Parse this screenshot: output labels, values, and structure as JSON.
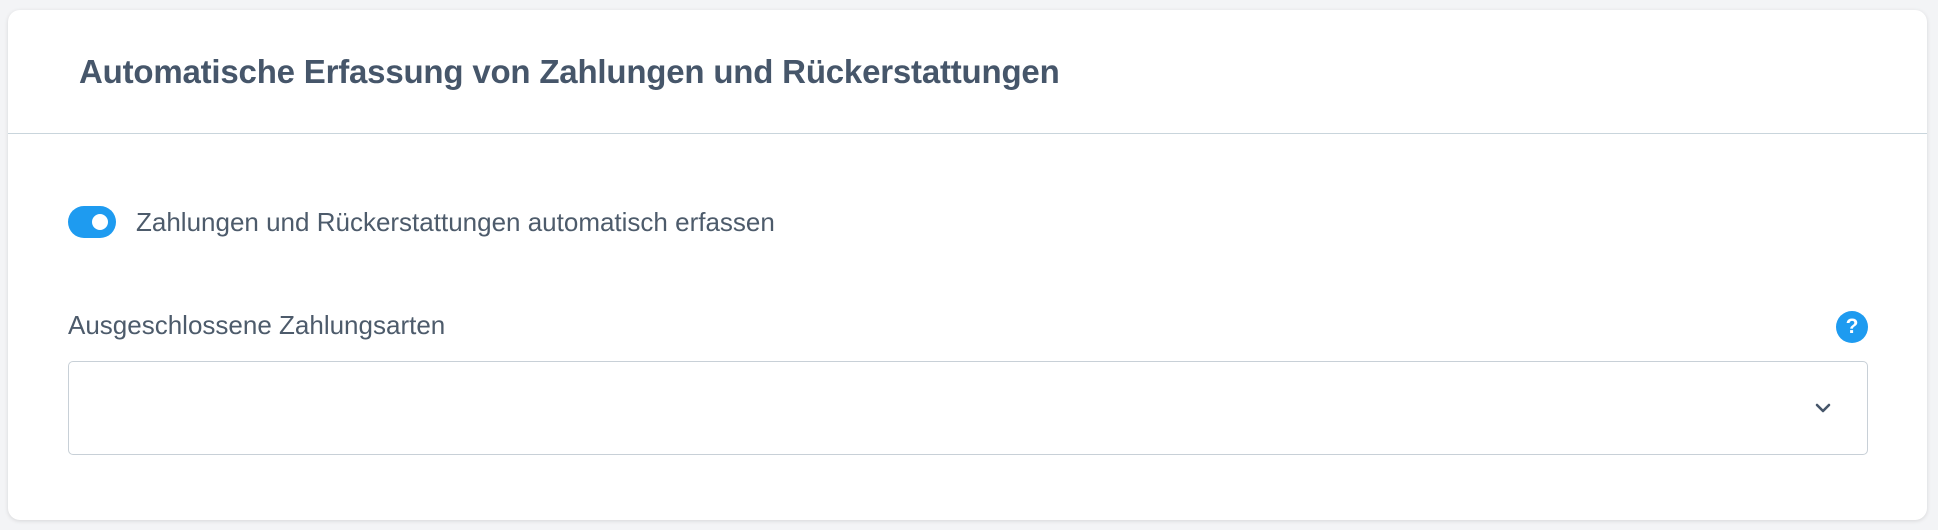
{
  "section": {
    "title": "Automatische Erfassung von Zahlungen und Rückerstattungen"
  },
  "auto_capture": {
    "label": "Zahlungen und Rückerstattungen automatisch erfassen",
    "enabled": true
  },
  "excluded_methods": {
    "label": "Ausgeschlossene Zahlungsarten",
    "selected_value": "",
    "help_icon": "question-icon",
    "help_glyph": "?",
    "dropdown_icon": "chevron-down-icon"
  },
  "colors": {
    "accent": "#1e9bf0",
    "title_text": "#46566a",
    "body_text": "#4d5b6b",
    "divider": "#c9d5dc"
  }
}
